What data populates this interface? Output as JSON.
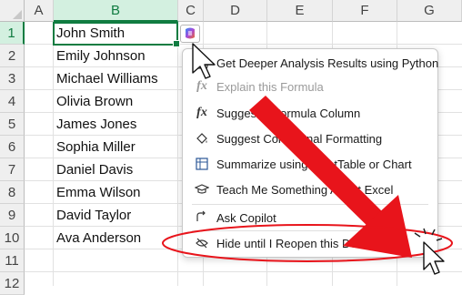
{
  "columns": [
    "A",
    "B",
    "C",
    "D",
    "E",
    "F",
    "G"
  ],
  "rows": [
    "1",
    "2",
    "3",
    "4",
    "5",
    "6",
    "7",
    "8",
    "9",
    "10",
    "11",
    "12"
  ],
  "names": [
    "John Smith",
    "Emily Johnson",
    "Michael Williams",
    "Olivia Brown",
    "James Jones",
    "Sophia Miller",
    "Daniel Davis",
    "Emma Wilson",
    "David Taylor",
    "Ava Anderson"
  ],
  "menu": {
    "items": [
      {
        "label": "Get Deeper Analysis Results using Python",
        "icon": "python-analysis-icon"
      },
      {
        "label": "Explain this Formula",
        "icon": "fx-icon"
      },
      {
        "label": "Suggest a Formula Column",
        "icon": "fx-icon"
      },
      {
        "label": "Suggest Conditional Formatting",
        "icon": "paint-bucket-icon"
      },
      {
        "label": "Summarize using PivotTable or Chart",
        "icon": "pivot-table-icon"
      },
      {
        "label": "Teach Me Something About Excel",
        "icon": "graduation-cap-icon"
      },
      {
        "label": "Ask Copilot",
        "icon": "ask-copilot-icon"
      },
      {
        "label": "Hide until I Reopen this Document",
        "icon": "hide-eye-icon"
      }
    ]
  },
  "colors": {
    "accent": "#107c41",
    "annotation": "#e8141b"
  }
}
